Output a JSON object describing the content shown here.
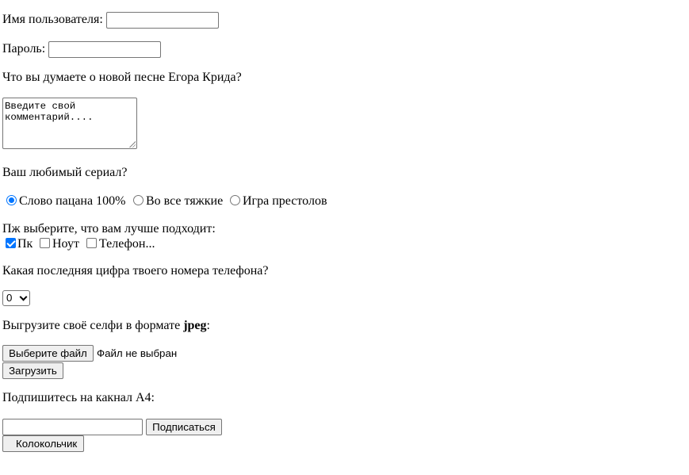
{
  "username": {
    "label": "Имя пользователя:",
    "value": ""
  },
  "password": {
    "label": "Пароль:",
    "value": ""
  },
  "song_question": "Что вы думаете о новой песне Егора Крида?",
  "comment": {
    "placeholder": "Введите свой комментарий...."
  },
  "series": {
    "question": "Ваш любимый сериал?",
    "options": [
      "Слово пацана 100%",
      "Во все тяжкие",
      "Игра престолов"
    ],
    "selected": 0
  },
  "device": {
    "question": "Пж выберите, что вам лучше подходит:",
    "options": [
      "Пк",
      "Ноут",
      "Телефон..."
    ],
    "checked": [
      true,
      false,
      false
    ]
  },
  "phone_digit": {
    "question": "Какая последняя цифра твоего номера телефона?",
    "selected": "0"
  },
  "selfie": {
    "question_prefix": "Выгрузите своё селфи в формате ",
    "question_bold": "jpeg",
    "question_suffix": ":",
    "choose_button": "Выберите файл",
    "no_file": "Файл не выбран",
    "upload_button": "Загрузить"
  },
  "subscribe": {
    "question": "Подпишитесь на какнал А4:",
    "email_value": "",
    "subscribe_button": "Подписаться",
    "bell_button": "Колокольчик"
  },
  "colors": {
    "accent": "#0075ff",
    "border": "#767676",
    "button_bg": "#efefef"
  }
}
